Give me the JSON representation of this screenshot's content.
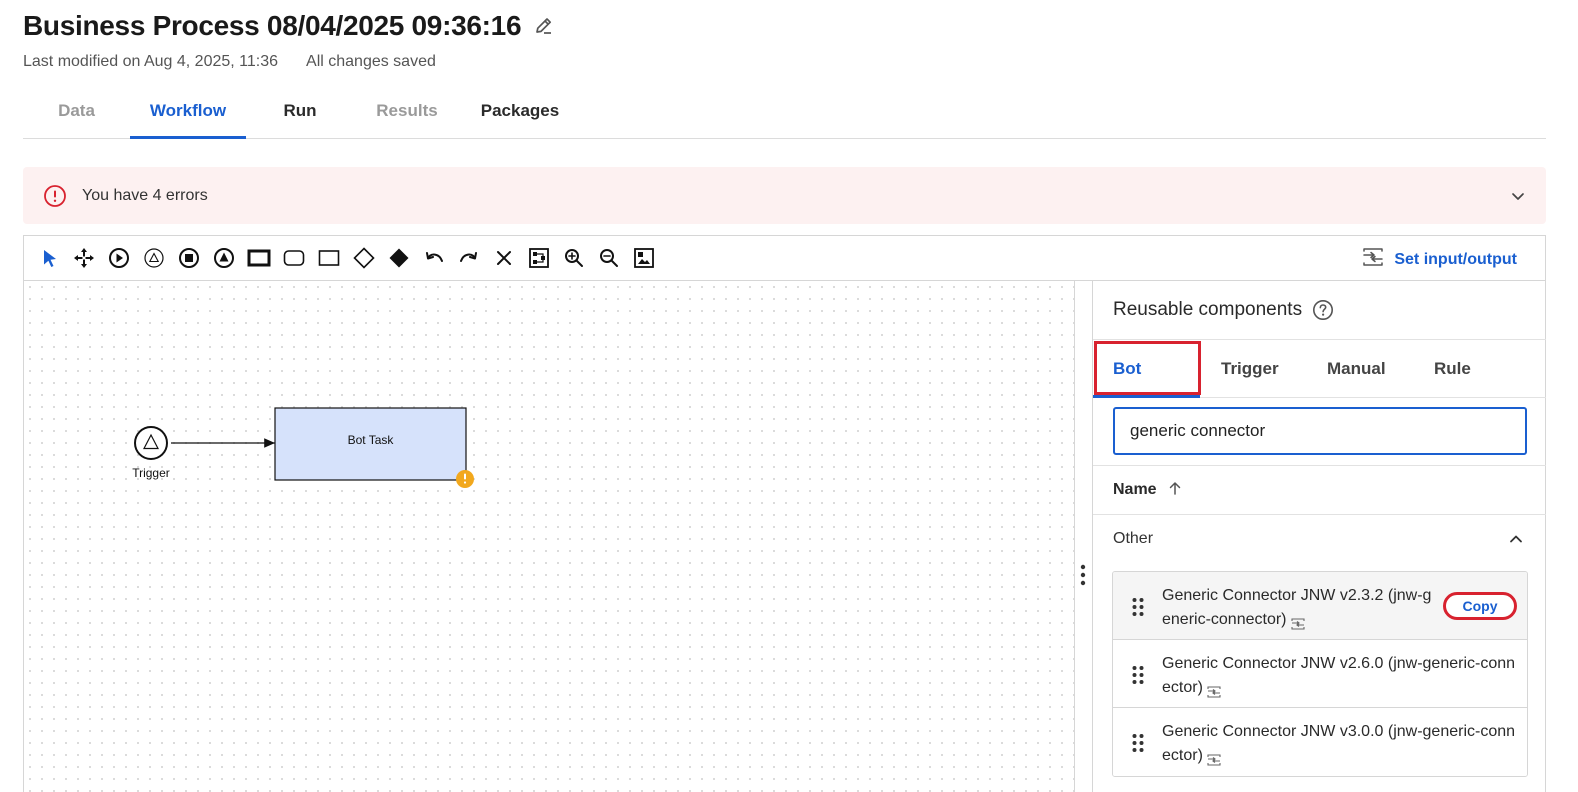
{
  "header": {
    "title": "Business Process 08/04/2025 09:36:16",
    "last_modified": "Last modified on Aug 4, 2025, 11:36",
    "save_status": "All changes saved"
  },
  "tabs": [
    "Data",
    "Workflow",
    "Run",
    "Results",
    "Packages"
  ],
  "active_tab": "Workflow",
  "error_banner": {
    "text": "You have 4 errors",
    "color": "#d8222f"
  },
  "toolbar": {
    "tools": [
      "select-pointer",
      "move",
      "start-event",
      "trigger-event",
      "end-event",
      "escalation-event",
      "bot-task",
      "rounded-task",
      "task",
      "gateway",
      "filled-gateway",
      "undo",
      "redo",
      "delete",
      "auto-layout",
      "zoom-in",
      "zoom-out",
      "fit-view"
    ],
    "set_io_label": "Set input/output"
  },
  "canvas": {
    "start_node_label": "Trigger",
    "task_node_label": "Bot Task",
    "task_fill": "#d6e2fb",
    "warning_color": "#f2a81d"
  },
  "panel": {
    "title": "Reusable components",
    "tabs": [
      "Bot",
      "Trigger",
      "Manual",
      "Rule"
    ],
    "active_tab": "Bot",
    "search_value": "generic connector",
    "sort_label": "Name",
    "group_label": "Other",
    "items": [
      {
        "name": "Generic Connector JNW v2.3.2 (jnw-generic-connector)",
        "action": "Copy"
      },
      {
        "name": "Generic Connector JNW v2.6.0 (jnw-generic-connector)"
      },
      {
        "name": "Generic Connector JNW v3.0.0 (jnw-generic-connector)"
      }
    ]
  },
  "colors": {
    "accent": "#1a5fd0",
    "highlight": "#d8222f"
  }
}
